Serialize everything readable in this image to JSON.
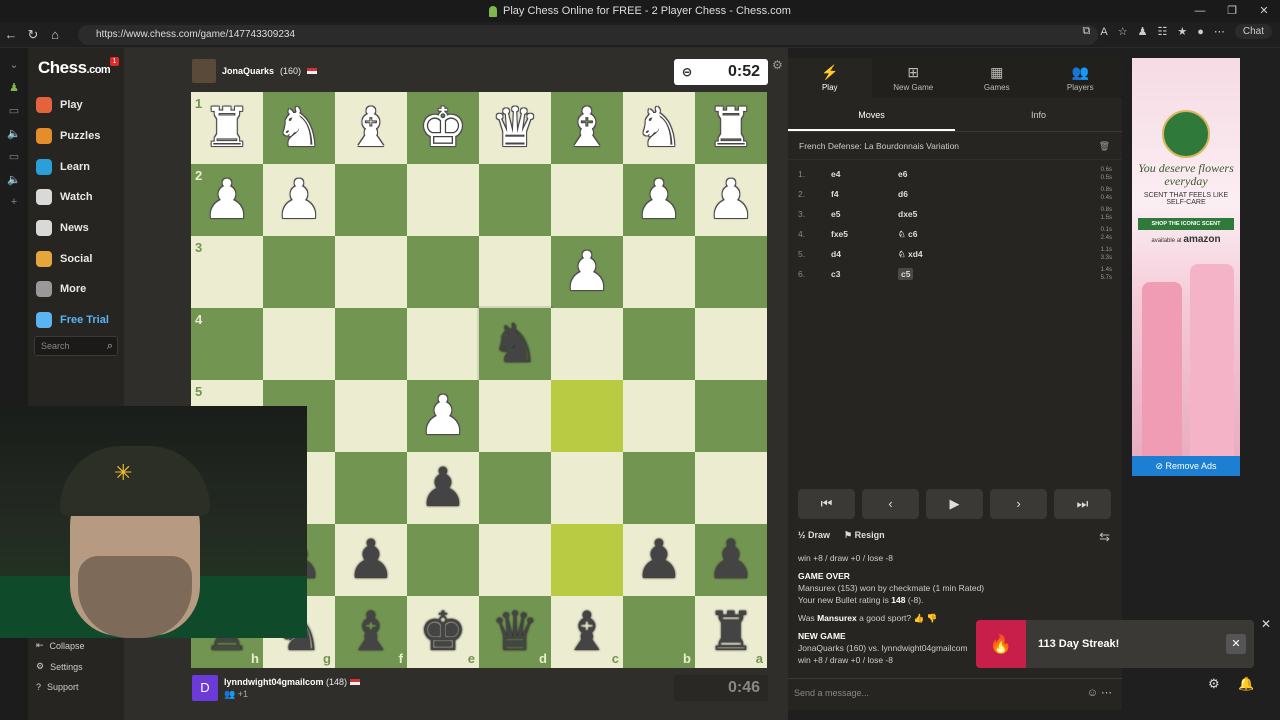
{
  "browser": {
    "title": "Play Chess Online for FREE - 2 Player Chess - Chess.com",
    "url": "https://www.chess.com/game/147743309234",
    "chat_label": "Chat"
  },
  "sidebar": {
    "logo": "Chess",
    "logo_suffix": ".com",
    "badge": "1",
    "items": [
      {
        "label": "Play",
        "color": "#e5633b"
      },
      {
        "label": "Puzzles",
        "color": "#e58d2b"
      },
      {
        "label": "Learn",
        "color": "#2b9fd9"
      },
      {
        "label": "Watch",
        "color": "#d9d9d9"
      },
      {
        "label": "News",
        "color": "#d9d9d9"
      },
      {
        "label": "Social",
        "color": "#e5a73b"
      },
      {
        "label": "More",
        "color": "#999999"
      },
      {
        "label": "Free Trial",
        "color": "#5ab4f0"
      }
    ],
    "search_placeholder": "Search",
    "collapse": "Collapse",
    "settings": "Settings",
    "support": "Support"
  },
  "top_player": {
    "name": "JonaQuarks",
    "rating": "(160)",
    "clock": "0:52"
  },
  "bottom_player": {
    "name": "lynndwight04gmailcom",
    "rating": "(148)",
    "initial": "D",
    "friends": "+1",
    "clock": "0:46"
  },
  "board": {
    "ranks": [
      "1",
      "2",
      "3",
      "4",
      "5",
      "6",
      "7",
      "8"
    ],
    "files": [
      "h",
      "g",
      "f",
      "e",
      "d",
      "c",
      "b",
      "a"
    ],
    "rows": [
      [
        "wr",
        "wn",
        "wb",
        "wk",
        "wq",
        "wb",
        "wn",
        "wr"
      ],
      [
        "wp",
        "wp",
        "",
        "",
        "",
        "",
        "wp",
        "wp"
      ],
      [
        "",
        "",
        "",
        "",
        "",
        "wp",
        "",
        ""
      ],
      [
        "",
        "",
        "",
        "",
        "bn",
        "",
        "",
        ""
      ],
      [
        "",
        "",
        "",
        "wp",
        "",
        "",
        "",
        ""
      ],
      [
        "",
        "",
        "",
        "bp",
        "",
        "",
        "",
        ""
      ],
      [
        "bp",
        "bp",
        "bp",
        "",
        "",
        "",
        "bp",
        "bp"
      ],
      [
        "br",
        "bn",
        "bb",
        "bk",
        "bq",
        "bb",
        "",
        "br"
      ]
    ],
    "highlights": [
      [
        4,
        5
      ],
      [
        6,
        5
      ]
    ],
    "selected": [
      3,
      4
    ]
  },
  "panel": {
    "tabs": [
      "Play",
      "New Game",
      "Games",
      "Players"
    ],
    "subtabs": [
      "Moves",
      "Info"
    ],
    "opening": "French Defense: La Bourdonnais Variation",
    "moves": [
      {
        "n": "1.",
        "w": "e4",
        "b": "e6",
        "tw": "0.6s",
        "tb": "0.5s"
      },
      {
        "n": "2.",
        "w": "f4",
        "b": "d6",
        "tw": "0.8s",
        "tb": "0.4s"
      },
      {
        "n": "3.",
        "w": "e5",
        "b": "dxe5",
        "tw": "0.8s",
        "tb": "1.5s"
      },
      {
        "n": "4.",
        "w": "fxe5",
        "b": "♘ c6",
        "tw": "0.1s",
        "tb": "2.4s"
      },
      {
        "n": "5.",
        "w": "d4",
        "b": "♘ xd4",
        "tw": "1.1s",
        "tb": "3.3s"
      },
      {
        "n": "6.",
        "w": "c3",
        "b": "c5",
        "tw": "1.4s",
        "tb": "5.7s"
      }
    ],
    "draw": "Draw",
    "resign": "Resign",
    "log_line1": "win +8 / draw +0 / lose -8",
    "game_over": "GAME OVER",
    "result": "Mansurex (153) won by checkmate (1 min Rated)",
    "rating_line_pre": "Your new Bullet rating is",
    "rating_val": "148",
    "rating_delta": "(-8).",
    "sport_pre": "Was",
    "sport_name": "Mansurex",
    "sport_post": "a good sport?",
    "new_game": "NEW GAME",
    "ng_line": "JonaQuarks (160) vs. lynndwight04gmailcom",
    "ng_line2": "win +8 / draw +0 / lose -8",
    "message_placeholder": "Send a message..."
  },
  "ad": {
    "headline": "You deserve flowers everyday",
    "sub": "SCENT THAT FEELS LIKE SELF-CARE",
    "button": "SHOP THE ICONIC SCENT",
    "avail": "available at",
    "store": "amazon",
    "remove": "Remove Ads"
  },
  "streak": {
    "text": "113 Day Streak!"
  }
}
